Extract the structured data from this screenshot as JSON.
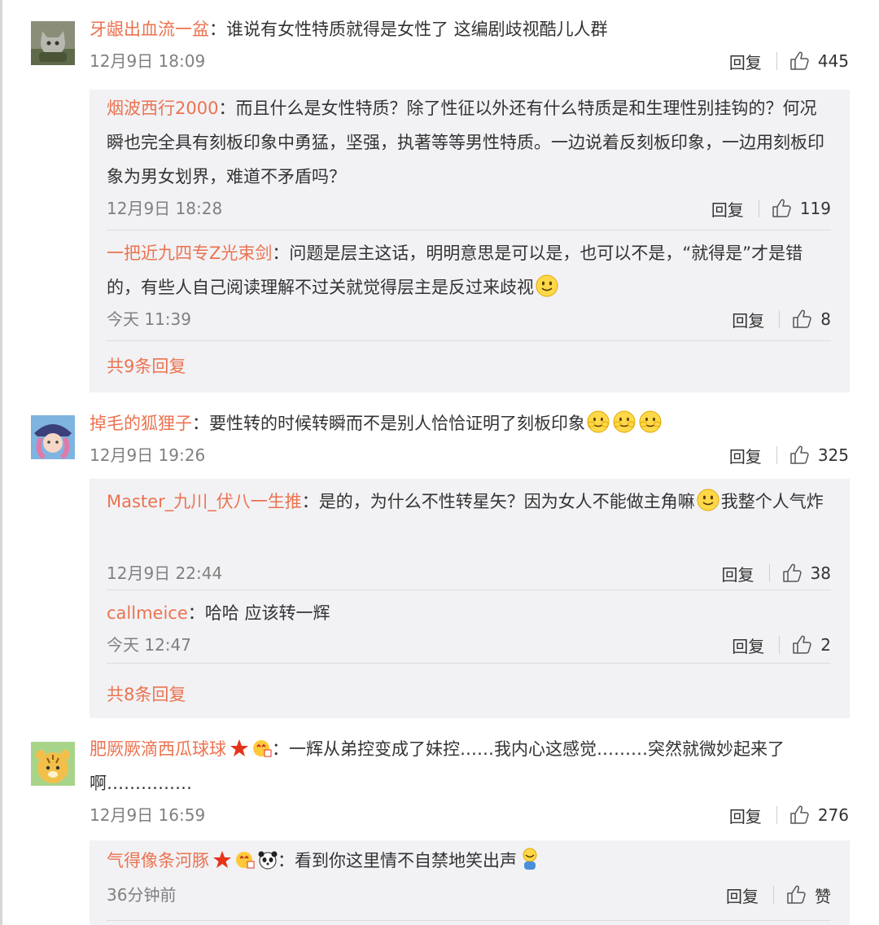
{
  "ui": {
    "reply_label": "回复"
  },
  "comments": [
    {
      "user": "牙龈出血流一盆",
      "text": "谁说有女性特质就得是女性了 这编剧歧视酷儿人群",
      "time": "12月9日 18:09",
      "likes": "445",
      "replies": [
        {
          "user": "烟波西行2000",
          "text": "而且什么是女性特质？除了性征以外还有什么特质是和生理性别挂钩的？何况瞬也完全具有刻板印象中勇猛，坚强，执著等等男性特质。一边说着反刻板印象，一边用刻板印象为男女划界，难道不矛盾吗？",
          "time": "12月9日 18:28",
          "likes": "119"
        },
        {
          "user": "一把近九四专Z光束剑",
          "text": "问题是层主这话，明明意思是可以是，也可以不是，“就得是”才是错的，有些人自己阅读理解不过关就觉得层主是反过来歧视",
          "time": "今天 11:39",
          "likes": "8"
        }
      ],
      "more": "共9条回复"
    },
    {
      "user": "掉毛的狐狸子",
      "text": "要性转的时候转瞬而不是别人恰恰证明了刻板印象",
      "time": "12月9日 19:26",
      "likes": "325",
      "replies": [
        {
          "user": "Master_九川_伏八一生推",
          "text_a": "是的，为什么不性转星矢？因为女人不能做主角嘛",
          "text_b": "我整个人气炸",
          "time": "12月9日 22:44",
          "likes": "38"
        },
        {
          "user": "callmeice",
          "text": "哈哈 应该转一辉",
          "time": "今天 12:47",
          "likes": "2"
        }
      ],
      "more": "共8条回复"
    },
    {
      "user": "肥厥厥滴西瓜球球",
      "text": "一辉从弟控变成了妹控……我内心这感觉………突然就微妙起来了啊……………",
      "time": "12月9日 16:59",
      "likes": "276",
      "replies": [
        {
          "user": "气得像条河豚",
          "text": "看到你这里情不自禁地笑出声",
          "time": "36分钟前",
          "likes": "赞"
        }
      ]
    }
  ]
}
